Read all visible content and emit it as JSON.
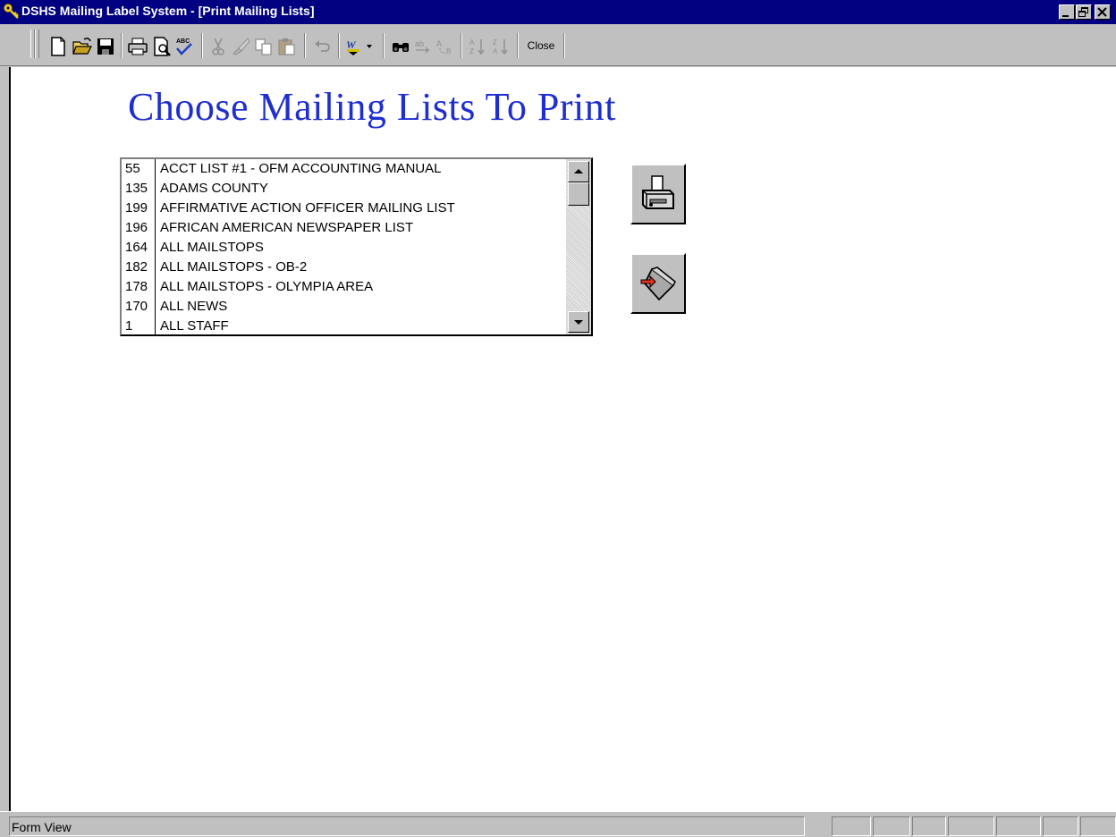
{
  "window": {
    "title": "DSHS Mailing Label System - [Print Mailing Lists]",
    "title_bar_color": "#000080",
    "app_icon": "keys-icon"
  },
  "toolbar": {
    "buttons": [
      {
        "name": "new-icon"
      },
      {
        "name": "open-icon"
      },
      {
        "name": "save-icon"
      },
      {
        "name": "print-icon"
      },
      {
        "name": "print-preview-icon"
      },
      {
        "name": "spelling-icon"
      },
      {
        "name": "cut-icon"
      },
      {
        "name": "format-painter-icon"
      },
      {
        "name": "copy-icon"
      },
      {
        "name": "paste-icon"
      },
      {
        "name": "undo-icon"
      },
      {
        "name": "office-links-icon"
      },
      {
        "name": "find-icon"
      },
      {
        "name": "replace-icon"
      },
      {
        "name": "goto-icon"
      },
      {
        "name": "sort-ascending-icon"
      },
      {
        "name": "sort-descending-icon"
      }
    ],
    "close_label": "Close"
  },
  "form": {
    "heading": "Choose Mailing Lists To Print",
    "heading_color": "#1e2ed0",
    "mailing_lists": [
      {
        "id": "55",
        "name": "ACCT LIST #1 - OFM ACCOUNTING MANUAL"
      },
      {
        "id": "135",
        "name": "ADAMS COUNTY"
      },
      {
        "id": "199",
        "name": "AFFIRMATIVE ACTION OFFICER MAILING LIST"
      },
      {
        "id": "196",
        "name": "AFRICAN AMERICAN NEWSPAPER LIST"
      },
      {
        "id": "164",
        "name": "ALL MAILSTOPS"
      },
      {
        "id": "182",
        "name": "ALL MAILSTOPS - OB-2"
      },
      {
        "id": "178",
        "name": "ALL MAILSTOPS - OLYMPIA AREA"
      },
      {
        "id": "170",
        "name": "ALL NEWS"
      },
      {
        "id": "1",
        "name": "ALL STAFF"
      }
    ],
    "print_button_icon": "printer-icon",
    "exit_button_icon": "exit-door-icon"
  },
  "statusbar": {
    "text": "Form View"
  }
}
